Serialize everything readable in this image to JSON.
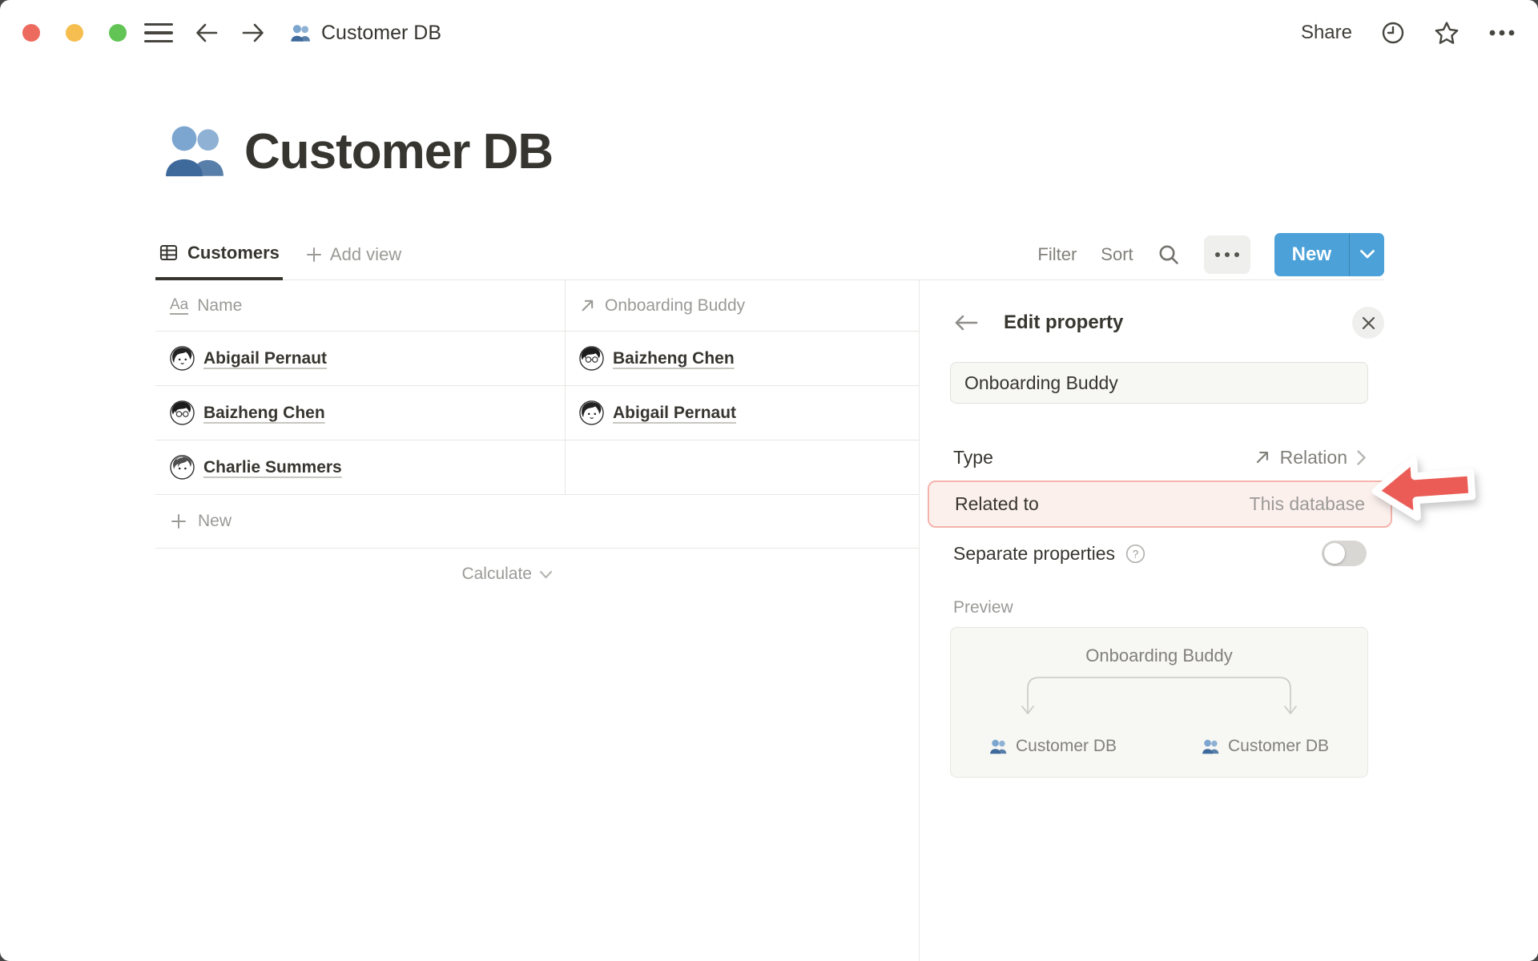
{
  "titlebar": {
    "breadcrumb": "Customer DB",
    "share_label": "Share"
  },
  "page": {
    "icon": "people-icon",
    "title": "Customer DB"
  },
  "toolbar": {
    "view_tab": "Customers",
    "add_view": "Add view",
    "filter": "Filter",
    "sort": "Sort",
    "new_button": "New"
  },
  "table": {
    "columns": [
      {
        "icon": "text-type-icon",
        "icon_glyph": "Aa",
        "label": "Name"
      },
      {
        "icon": "relation-icon",
        "label": "Onboarding Buddy"
      }
    ],
    "rows": [
      {
        "name": "Abigail Pernaut",
        "avatar": "abigail-avatar",
        "avatar_ref": "#av-abigail",
        "buddy": "Baizheng Chen",
        "buddy_avatar": "baizheng-avatar",
        "buddy_avatar_ref": "#av-baizheng"
      },
      {
        "name": "Baizheng Chen",
        "avatar": "baizheng-avatar",
        "avatar_ref": "#av-baizheng",
        "buddy": "Abigail Pernaut",
        "buddy_avatar": "abigail-avatar",
        "buddy_avatar_ref": "#av-abigail"
      },
      {
        "name": "Charlie Summers",
        "avatar": "charlie-avatar",
        "avatar_ref": "#av-charlie",
        "buddy": "",
        "buddy_avatar": "",
        "buddy_avatar_ref": ""
      }
    ],
    "new_row": "New",
    "calculate": "Calculate"
  },
  "panel": {
    "title": "Edit property",
    "name_value": "Onboarding Buddy",
    "type_label": "Type",
    "type_value": "Relation",
    "related_label": "Related to",
    "related_value": "This database",
    "separate_label": "Separate properties",
    "preview_label": "Preview",
    "preview": {
      "property": "Onboarding Buddy",
      "left_db": "Customer DB",
      "right_db": "Customer DB"
    }
  },
  "colors": {
    "accent_blue": "#4BA1D8",
    "highlight_pink_bg": "#FCF0ED",
    "highlight_pink_border": "#F4B4AC",
    "annotation_red": "#EA5C55",
    "traffic_red": "#ED6A5E",
    "traffic_yellow": "#F5BE4F",
    "traffic_green": "#61C454",
    "text_dark": "#37352F",
    "text_gray": "#9B9A97"
  }
}
